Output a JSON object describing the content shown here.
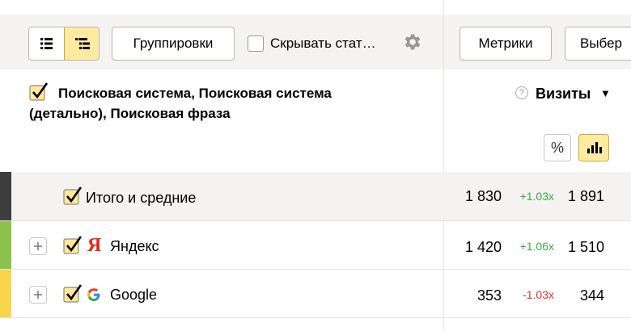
{
  "toolbar": {
    "groupings_label": "Группировки",
    "hide_stats_label": "Скрывать стат…",
    "metrics_label": "Метрики",
    "choose_label": "Выбер"
  },
  "header": {
    "dimensions_title": "Поисковая система, Поисковая система (детально), Поисковая фраза",
    "metric_label": "Визиты",
    "metric_sort_indicator": "▼",
    "help_icon": "?",
    "percent_icon": "%"
  },
  "rows": [
    {
      "label": "Итого и средние",
      "value1": "1 830",
      "delta": "+1.03x",
      "delta_color": "#3ea83e",
      "value2": "1 891",
      "stripe": "#3d3d3d",
      "icon": null
    },
    {
      "label": "Яндекс",
      "value1": "1 420",
      "delta": "+1.06x",
      "delta_color": "#3ea83e",
      "value2": "1 510",
      "stripe": "#8bc34a",
      "icon": "yandex-logo-icon"
    },
    {
      "label": "Google",
      "value1": "353",
      "delta": "-1.03x",
      "delta_color": "#e0312f",
      "value2": "344",
      "stripe": "#f6d54a",
      "icon": "google-logo-icon"
    }
  ],
  "colors": {
    "accent_yellow": "#ffeba0",
    "positive": "#3ea83e",
    "negative": "#e0312f"
  }
}
